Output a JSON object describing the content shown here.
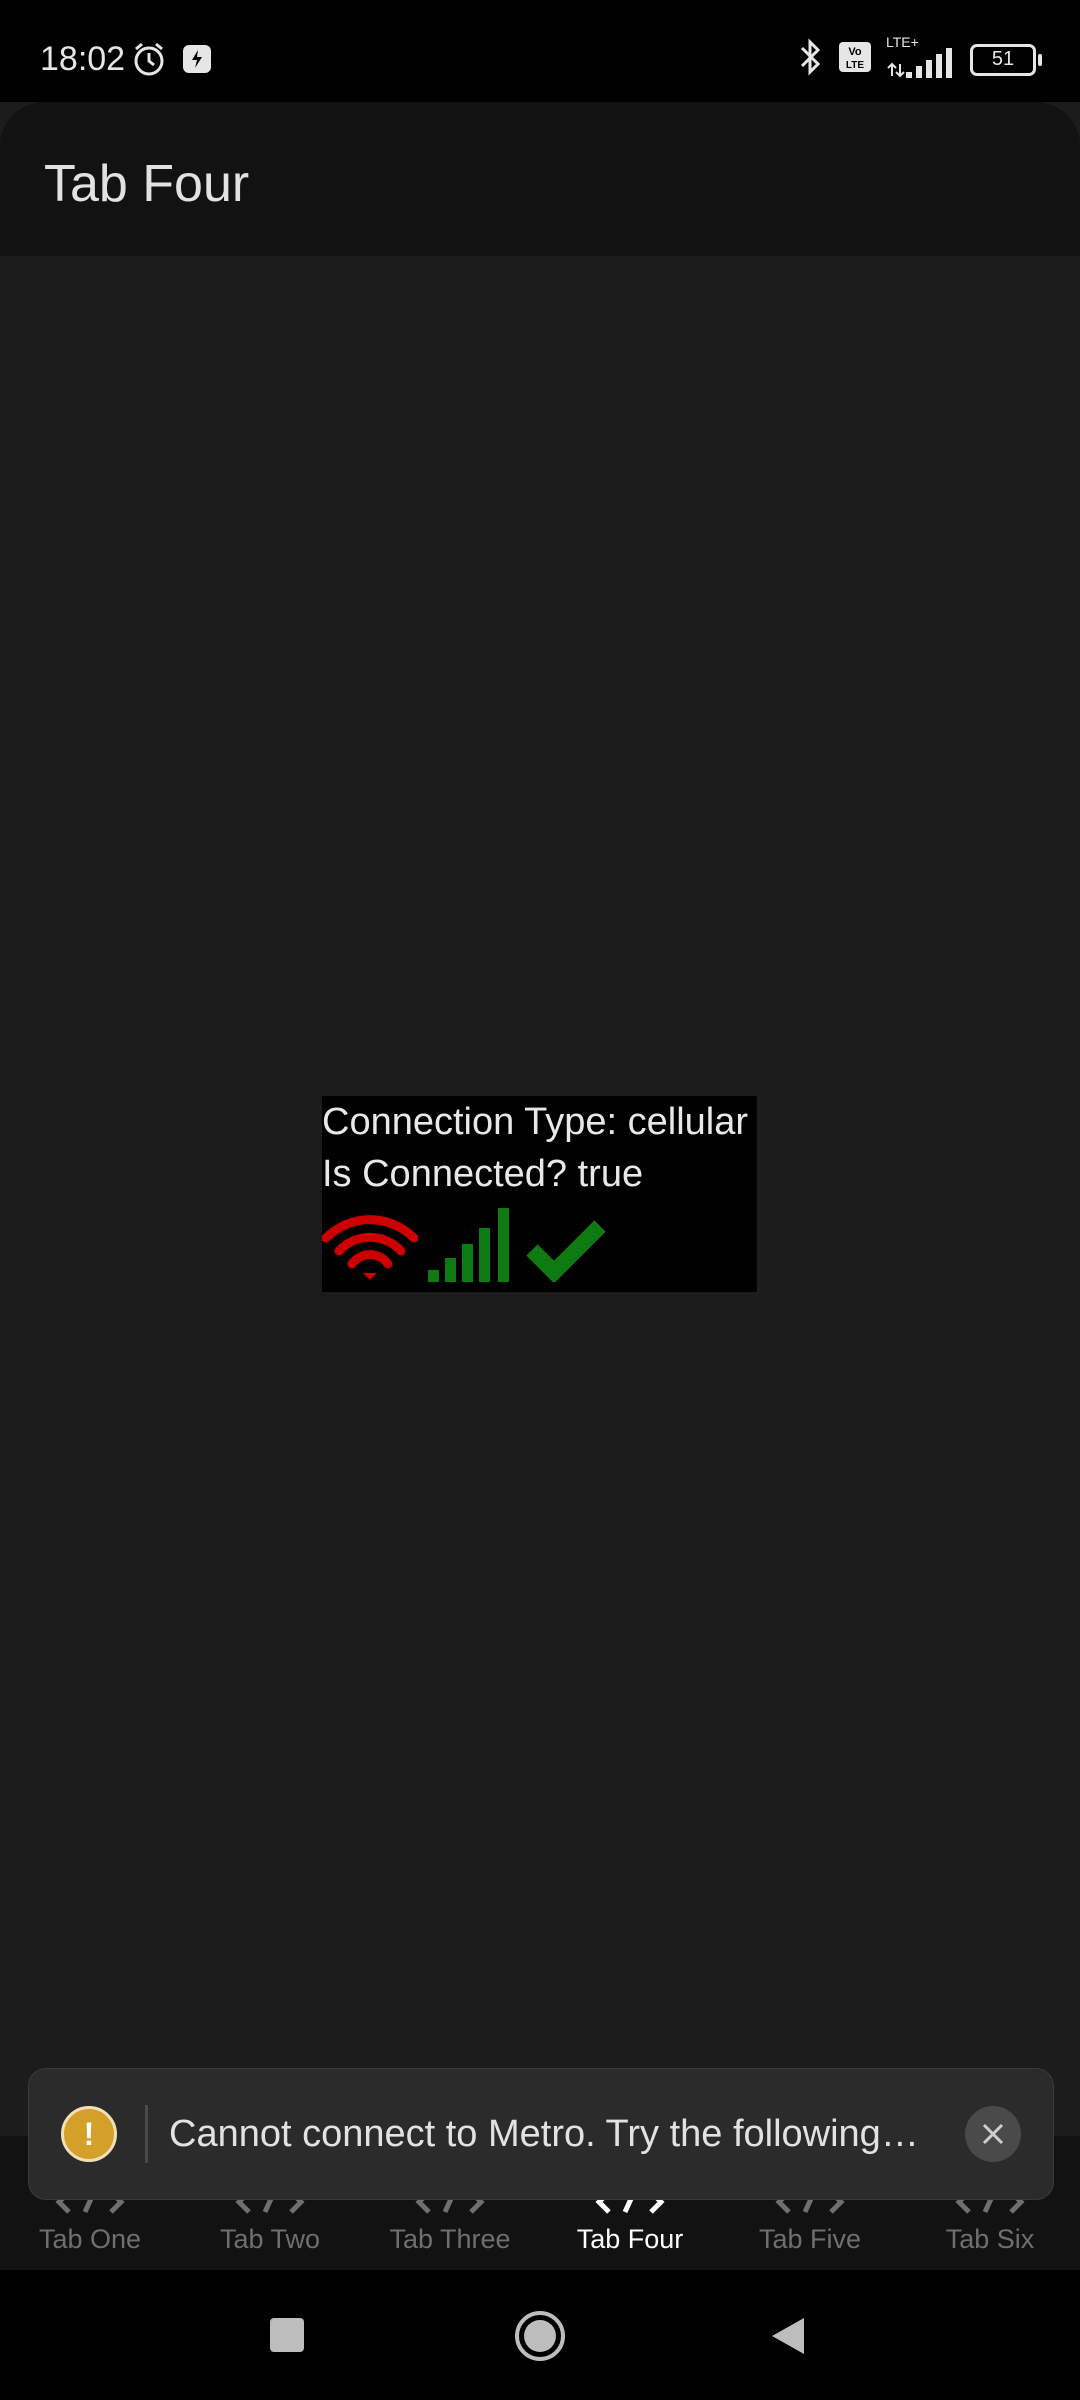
{
  "status_bar": {
    "time": "18:02",
    "battery": "51",
    "network": "LTE+",
    "icons": [
      "alarm-icon",
      "app-notification-icon",
      "bluetooth-icon",
      "volte-icon",
      "signal-icon",
      "battery-icon"
    ]
  },
  "header": {
    "title": "Tab Four"
  },
  "connection": {
    "type_line": "Connection Type: cellular",
    "connected_line": "Is Connected? true",
    "icons": [
      "wifi-icon",
      "cellular-signal-icon",
      "checkmark-icon"
    ],
    "colors": {
      "wifi": "#cc0000",
      "signal": "#0e7a12",
      "check": "#0e7a12"
    }
  },
  "tabs": [
    {
      "label": "Tab One",
      "active": false,
      "icon": "code-icon"
    },
    {
      "label": "Tab Two",
      "active": false,
      "icon": "code-icon"
    },
    {
      "label": "Tab Three",
      "active": false,
      "icon": "code-icon"
    },
    {
      "label": "Tab Four",
      "active": true,
      "icon": "code-icon"
    },
    {
      "label": "Tab Five",
      "active": false,
      "icon": "code-icon"
    },
    {
      "label": "Tab Six",
      "active": false,
      "icon": "code-icon"
    }
  ],
  "toast": {
    "message": "Cannot connect to Metro.  Try the following…",
    "icon": "warning-icon",
    "close_icon": "close-icon",
    "accent": "#d4a02a"
  },
  "nav_bar": {
    "icons": [
      "recents-icon",
      "home-icon",
      "back-icon"
    ]
  }
}
